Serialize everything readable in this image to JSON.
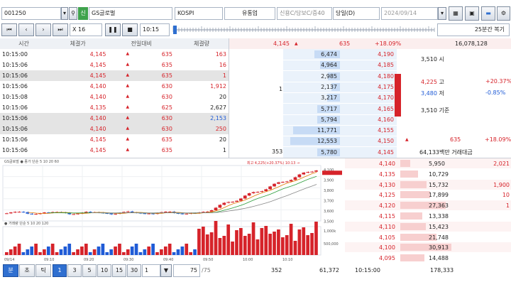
{
  "header": {
    "code": "001250",
    "market_tab": "신",
    "stock_name": "GS글로벌",
    "index": "KOSPI",
    "sector": "유통업",
    "credit": "신용C/담보C/증40",
    "daily": "당일(D)",
    "date": "2024/09/14"
  },
  "controls": {
    "speed": "X 16",
    "time": "10:15",
    "interval": "25분간 복기"
  },
  "trades": {
    "columns": [
      "시간",
      "체결가",
      "전일대비",
      "체결량"
    ],
    "rows": [
      {
        "time": "10:15:00",
        "price": "4,145",
        "chg": "635",
        "vol": "163",
        "vc": "red",
        "shade": false
      },
      {
        "time": "10:15:06",
        "price": "4,145",
        "chg": "635",
        "vol": "16",
        "vc": "red",
        "shade": false
      },
      {
        "time": "10:15:06",
        "price": "4,145",
        "chg": "635",
        "vol": "1",
        "vc": "red",
        "shade": true
      },
      {
        "time": "10:15:06",
        "price": "4,140",
        "chg": "630",
        "vol": "1,912",
        "vc": "red",
        "shade": false
      },
      {
        "time": "10:15:08",
        "price": "4,140",
        "chg": "630",
        "vol": "20",
        "vc": "dark",
        "shade": false
      },
      {
        "time": "10:15:06",
        "price": "4,135",
        "chg": "625",
        "vol": "2,627",
        "vc": "dark",
        "shade": false
      },
      {
        "time": "10:15:06",
        "price": "4,140",
        "chg": "630",
        "vol": "2,153",
        "vc": "blue",
        "shade": true
      },
      {
        "time": "10:15:06",
        "price": "4,140",
        "chg": "630",
        "vol": "250",
        "vc": "red",
        "shade": true
      },
      {
        "time": "10:15:06",
        "price": "4,145",
        "chg": "635",
        "vol": "20",
        "vc": "dark",
        "shade": false
      },
      {
        "time": "10:15:06",
        "price": "4,145",
        "chg": "635",
        "vol": "1",
        "vc": "dark",
        "shade": false
      }
    ]
  },
  "orderbook": {
    "top_price": "4,145",
    "top_chg": "635",
    "top_pct": "+18.09%",
    "top_vol": "16,078,128",
    "left_label": "1",
    "left_bottom": "353",
    "ask": [
      {
        "qty": "6,474",
        "price": "4,190"
      },
      {
        "qty": "4,964",
        "price": "4,185"
      },
      {
        "qty": "2,985",
        "price": "4,180"
      },
      {
        "qty": "2,137",
        "price": "4,175"
      },
      {
        "qty": "3,217",
        "price": "4,170"
      },
      {
        "qty": "5,717",
        "price": "4,165"
      },
      {
        "qty": "5,794",
        "price": "4,160"
      },
      {
        "qty": "11,771",
        "price": "4,155"
      },
      {
        "qty": "12,553",
        "price": "4,150"
      },
      {
        "qty": "5,780",
        "price": "4,145"
      }
    ],
    "bid": [
      {
        "price": "4,140",
        "qty": "5,950",
        "extra": "2,021"
      },
      {
        "price": "4,135",
        "qty": "10,729",
        "extra": ""
      },
      {
        "price": "4,130",
        "qty": "15,732",
        "extra": "1,900"
      },
      {
        "price": "4,125",
        "qty": "17,899",
        "extra": "10"
      },
      {
        "price": "4,120",
        "qty": "27,363",
        "extra": "1"
      },
      {
        "price": "4,115",
        "qty": "13,338",
        "extra": ""
      },
      {
        "price": "4,110",
        "qty": "15,423",
        "extra": ""
      },
      {
        "price": "4,105",
        "qty": "21,748",
        "extra": ""
      },
      {
        "price": "4,100",
        "qty": "30,913",
        "extra": ""
      },
      {
        "price": "4,095",
        "qty": "14,488",
        "extra": ""
      }
    ],
    "info": {
      "open_val": "3,510",
      "open_lbl": "시",
      "high_val": "4,225",
      "high_lbl": "고",
      "high_pct": "+20.37%",
      "low_val": "3,480",
      "low_lbl": "저",
      "low_pct": "-0.85%",
      "base_val": "3,510",
      "base_lbl": "기준",
      "last_chg": "635",
      "last_pct": "+18.09%",
      "amount": "64,133백만 거래대금"
    }
  },
  "chart": {
    "label_top": "GS글로벌 ● 종가 단순 5 10 20 60",
    "label_vol": "● 거래량 단순 5 10 20 120",
    "annot": "최고 4,225(+20.37%) 10:13 →",
    "y_labels": [
      "4,100",
      "3,900",
      "3,800",
      "3,700",
      "3,600",
      "3,500"
    ],
    "vol_labels": [
      "1,000k",
      "500,000"
    ],
    "x_labels": [
      "09/14",
      "09:10",
      "09:20",
      "09:30",
      "09:40",
      "09:50",
      "10:00",
      "10:10"
    ]
  },
  "bottom": {
    "tabs": [
      "분",
      "초",
      "틱"
    ],
    "nums": [
      "1",
      "3",
      "5",
      "10",
      "15",
      "30"
    ],
    "input_val": "1",
    "count": "75",
    "total": "/75",
    "sum_left": "352",
    "sum_mid": "61,372",
    "sum_time": "10:15:00",
    "sum_right": "178,333"
  },
  "colors": {
    "up": "#d6232a",
    "down": "#1f5bd6",
    "accent": "#2f6fd0"
  }
}
